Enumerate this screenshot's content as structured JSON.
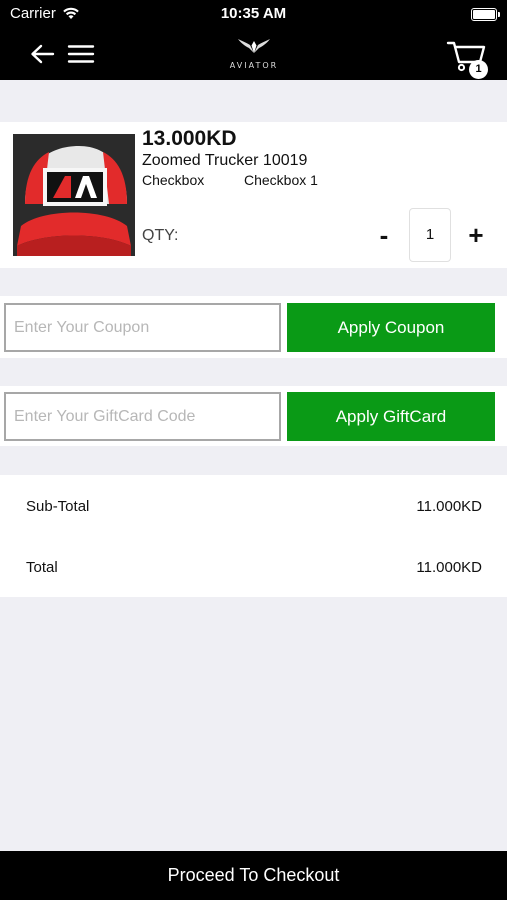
{
  "status_bar": {
    "carrier": "Carrier",
    "time": "10:35 AM",
    "battery_level": 1.0
  },
  "header": {
    "back_icon": "arrow-left-icon",
    "menu_icon": "hamburger-menu-icon",
    "logo_text": "AVIATOR",
    "cart_icon": "shopping-cart-icon",
    "cart_count": "1"
  },
  "product": {
    "price": "13.000KD",
    "name": "Zoomed Trucker 10019",
    "option_label": "Checkbox",
    "option_value": "Checkbox 1",
    "qty_label": "QTY:",
    "qty_minus": "-",
    "qty_plus": "+",
    "quantity": "1"
  },
  "coupon": {
    "placeholder": "Enter Your Coupon",
    "button_label": "Apply Coupon"
  },
  "giftcard": {
    "placeholder": "Enter Your GiftCard Code",
    "button_label": "Apply GiftCard"
  },
  "totals": {
    "subtotal_label": "Sub-Total",
    "subtotal_value": "11.000KD",
    "total_label": "Total",
    "total_value": "11.000KD"
  },
  "checkout": {
    "label": "Proceed To Checkout"
  },
  "colors": {
    "accent_green": "#0a9a16",
    "bar_black": "#000000",
    "background": "#efeff4"
  }
}
